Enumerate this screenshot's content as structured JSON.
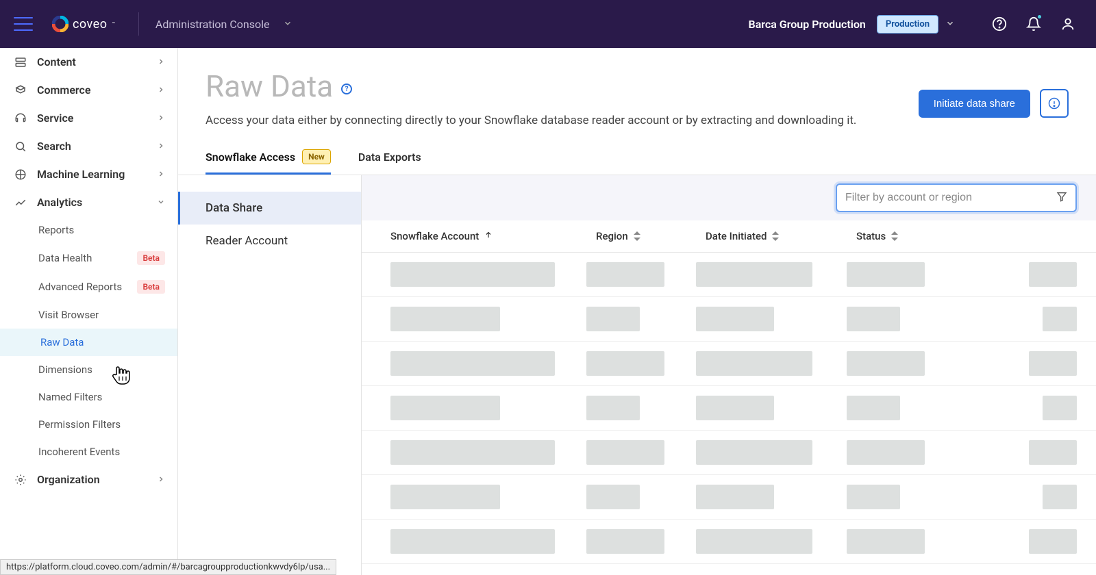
{
  "header": {
    "brand": "coveo",
    "console_label": "Administration Console",
    "org_name": "Barca Group Production",
    "env_badge": "Production"
  },
  "sidebar": {
    "items": [
      {
        "label": "Content",
        "icon": "content"
      },
      {
        "label": "Commerce",
        "icon": "commerce"
      },
      {
        "label": "Service",
        "icon": "service"
      },
      {
        "label": "Search",
        "icon": "search"
      },
      {
        "label": "Machine Learning",
        "icon": "ml"
      },
      {
        "label": "Analytics",
        "icon": "analytics",
        "expanded": true
      },
      {
        "label": "Organization",
        "icon": "org"
      }
    ],
    "analytics_sub": [
      {
        "label": "Reports"
      },
      {
        "label": "Data Health",
        "badge": "Beta"
      },
      {
        "label": "Advanced Reports",
        "badge": "Beta"
      },
      {
        "label": "Visit Browser"
      },
      {
        "label": "Raw Data",
        "active": true
      },
      {
        "label": "Dimensions"
      },
      {
        "label": "Named Filters"
      },
      {
        "label": "Permission Filters"
      },
      {
        "label": "Incoherent Events"
      }
    ]
  },
  "page": {
    "title": "Raw Data",
    "description": "Access your data either by connecting directly to your Snowflake database reader account or by extracting and downloading it.",
    "primary_action": "Initiate data share"
  },
  "tabs": {
    "t1": "Snowflake Access",
    "t1_badge": "New",
    "t2": "Data Exports"
  },
  "subnav": {
    "i1": "Data Share",
    "i2": "Reader Account"
  },
  "filter": {
    "placeholder": "Filter by account or region"
  },
  "columns": {
    "c1": "Snowflake Account",
    "c2": "Region",
    "c3": "Date Initiated",
    "c4": "Status"
  },
  "status_url": "https://platform.cloud.coveo.com/admin/#/barcagroupproductionkwvdy6lp/usa..."
}
